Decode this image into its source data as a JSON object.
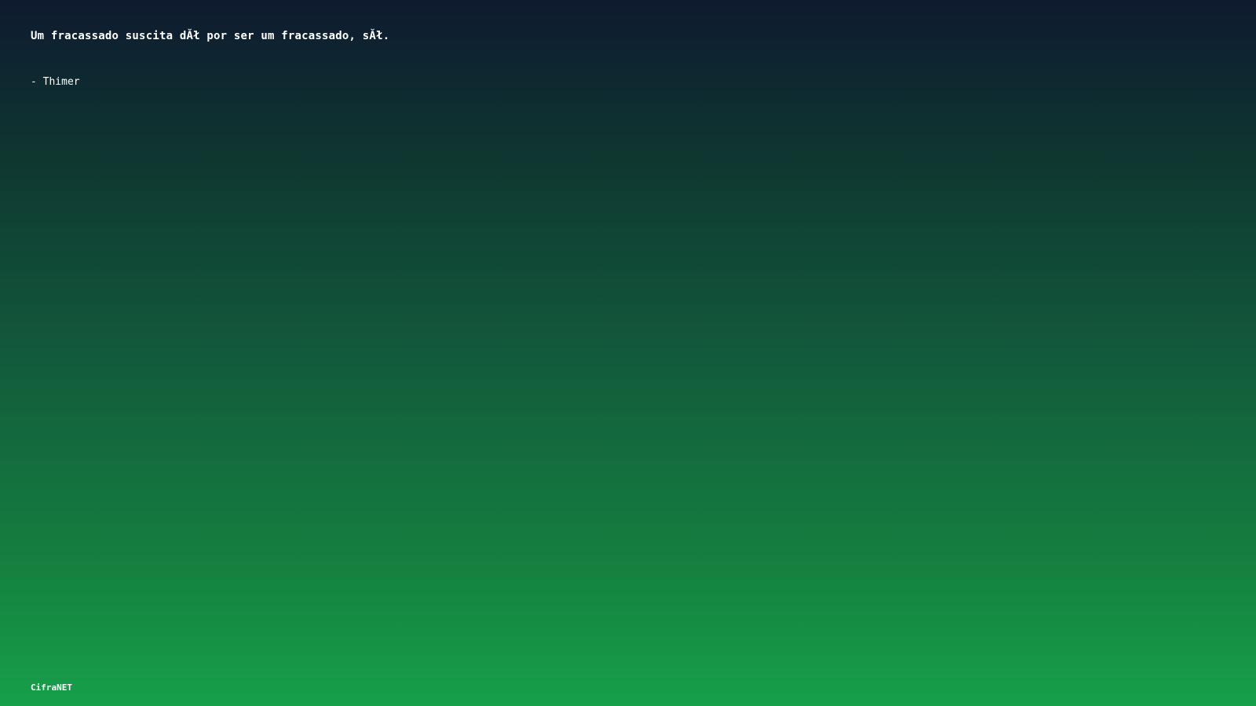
{
  "quote": {
    "text": "Um fracassado suscita dĂł por ser um fracassado, sĂł.",
    "author": "- Thimer"
  },
  "footer": {
    "brand": "CifraNET"
  },
  "colors": {
    "gradient_top": "#0e1a2f",
    "gradient_bottom": "#16a04a",
    "text": "#ffffff"
  }
}
